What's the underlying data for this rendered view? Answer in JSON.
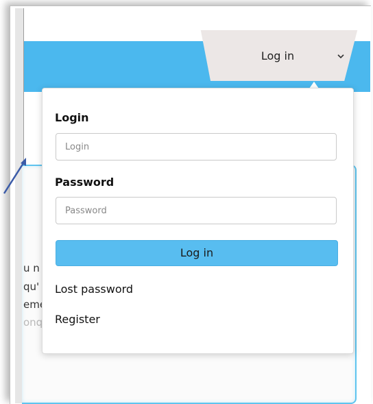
{
  "header": {
    "login_tab_label": "Log in",
    "chevron_icon": "chevron-down-icon"
  },
  "background": {
    "text_lines": [
      "u n",
      "qu'",
      "eme",
      "onq"
    ]
  },
  "dropdown": {
    "login_label": "Login",
    "login_placeholder": "Login",
    "password_label": "Password",
    "password_placeholder": "Password",
    "submit_label": "Log in",
    "lost_password_label": "Lost password",
    "register_label": "Register"
  },
  "colors": {
    "header_blue": "#4bb8ee",
    "button_blue": "#58bdf0",
    "tab_bg": "#ece7e6"
  }
}
